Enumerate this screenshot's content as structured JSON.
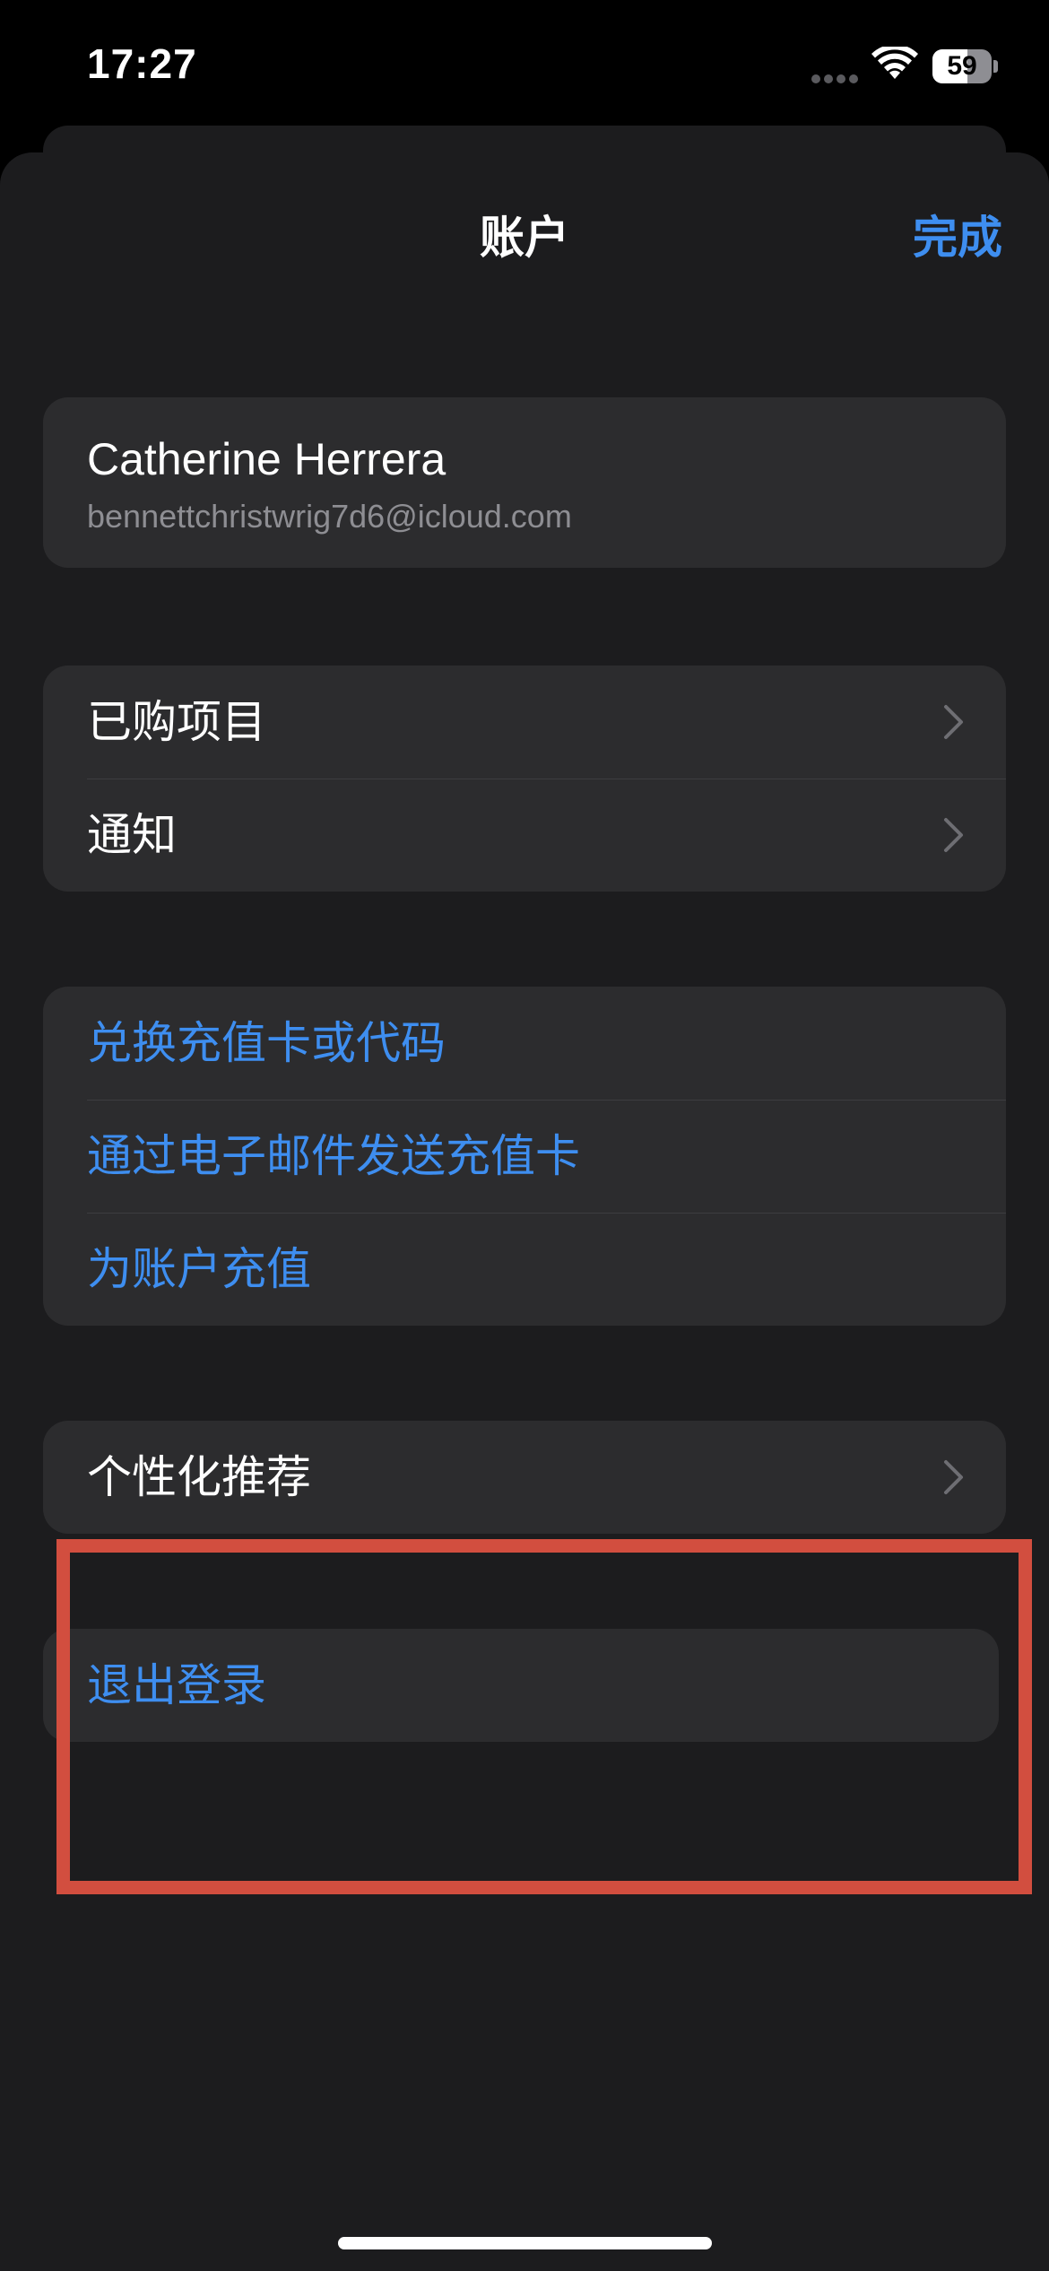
{
  "status_bar": {
    "time": "17:27",
    "battery_percent": "59",
    "battery_level": 0.59,
    "signal_icon": "cellular-dots-icon",
    "wifi_icon": "wifi-icon"
  },
  "nav": {
    "title": "账户",
    "done_label": "完成"
  },
  "account": {
    "name": "Catherine Herrera",
    "email": "bennettchristwrig7d6@icloud.com"
  },
  "group_purchases": {
    "items": [
      {
        "label": "已购项目",
        "icon": "chevron-right-icon"
      },
      {
        "label": "通知",
        "icon": "chevron-right-icon"
      }
    ]
  },
  "group_giftcards": {
    "items": [
      {
        "label": "兑换充值卡或代码"
      },
      {
        "label": "通过电子邮件发送充值卡"
      },
      {
        "label": "为账户充值"
      }
    ]
  },
  "group_personalize": {
    "items": [
      {
        "label": "个性化推荐",
        "icon": "chevron-right-icon"
      }
    ]
  },
  "logout": {
    "label": "退出登录"
  },
  "colors": {
    "accent": "#3e8ef0",
    "background": "#1c1c1e",
    "cell": "#2c2c2e",
    "highlight": "#d24e3f"
  }
}
